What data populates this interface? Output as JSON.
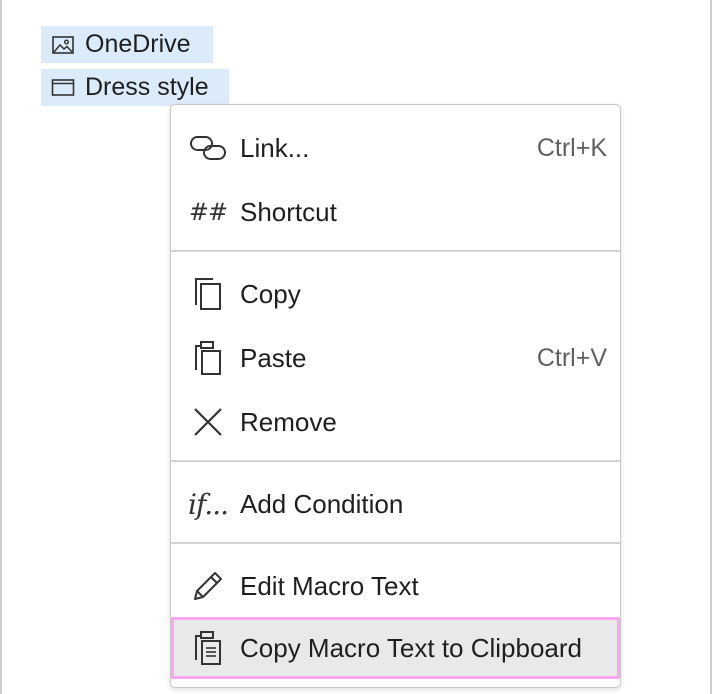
{
  "tree": {
    "items": [
      {
        "label": "OneDrive",
        "icon": "image-icon"
      },
      {
        "label": "Dress style",
        "icon": "window-icon"
      }
    ]
  },
  "context_menu": {
    "groups": [
      {
        "items": [
          {
            "label": "Link...",
            "shortcut": "Ctrl+K",
            "icon": "link-icon"
          },
          {
            "label": "Shortcut",
            "shortcut": "",
            "icon": "hash-icon",
            "glyph": "##"
          }
        ]
      },
      {
        "items": [
          {
            "label": "Copy",
            "shortcut": "",
            "icon": "copy-icon"
          },
          {
            "label": "Paste",
            "shortcut": "Ctrl+V",
            "icon": "paste-icon"
          },
          {
            "label": "Remove",
            "shortcut": "",
            "icon": "close-icon"
          }
        ]
      },
      {
        "items": [
          {
            "label": "Add Condition",
            "shortcut": "",
            "icon": "condition-icon",
            "glyph": "if..."
          }
        ]
      },
      {
        "items": [
          {
            "label": "Edit Macro Text",
            "shortcut": "",
            "icon": "pencil-icon"
          },
          {
            "label": "Copy Macro Text to Clipboard",
            "shortcut": "",
            "icon": "clipboard-copy-icon",
            "highlighted": true
          }
        ]
      }
    ]
  },
  "colors": {
    "selection_bg": "#dcebfa",
    "hover_bg": "#e9e9e9",
    "focus_outline": "#f7a6ef"
  }
}
